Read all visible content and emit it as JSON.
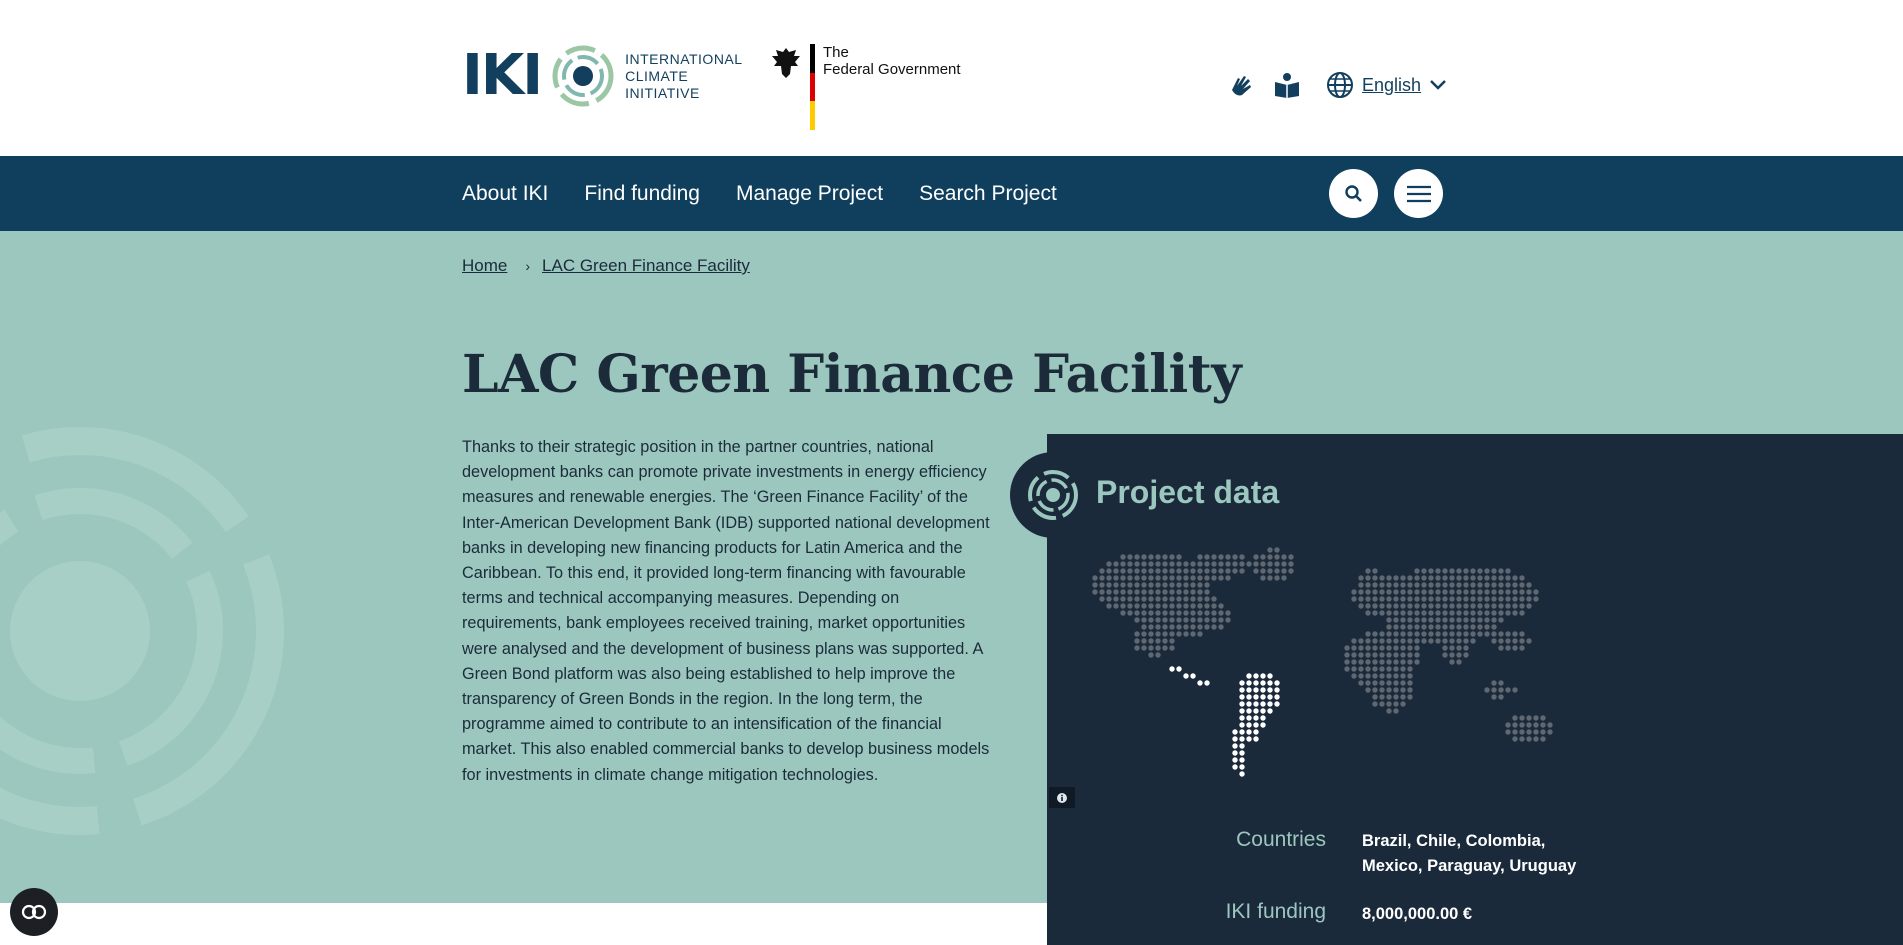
{
  "header": {
    "logo_letters": "IKI",
    "logo_text": [
      "INTERNATIONAL",
      "CLIMATE",
      "INITIATIVE"
    ],
    "gov_text": [
      "The",
      "Federal Government"
    ],
    "language": "English",
    "tools": [
      "sign-language-icon",
      "easy-read-icon",
      "globe-icon",
      "chevron-down-icon"
    ]
  },
  "nav": {
    "items": [
      "About IKI",
      "Find funding",
      "Manage Project",
      "Search Project"
    ],
    "search_icon": "search-icon",
    "menu_icon": "menu-icon"
  },
  "breadcrumb": {
    "home": "Home",
    "current": "LAC Green Finance Facility"
  },
  "page": {
    "title": "LAC Green Finance Facility",
    "intro": "Thanks to their strategic position in the partner countries, national development banks can promote private investments in energy efficiency measures and renewable energies. The ‘Green Finance Facility’ of the Inter-American Development Bank (IDB) supported national development banks in developing new financing products for Latin America and the Caribbean. To this end, it provided long-term financing with favourable terms and technical accompanying measures. Depending on requirements, bank employees received training, market opportunities were analysed and the development of business plans was supported. A Green Bond platform was also being established to help improve the transparency of Green Bonds in the region. In the long term, the programme aimed to contribute to an intensification of the financial market. This also enabled commercial banks to develop business models for investments in climate change mitigation technologies."
  },
  "project_data": {
    "title": "Project data",
    "countries_label": "Countries",
    "countries_value": [
      "Brazil, Chile, Colombia,",
      "Mexico, Paraguay, Uruguay"
    ],
    "funding_label": "IKI funding",
    "funding_value": "8,000,000.00 €"
  },
  "colors": {
    "navy": "#0f3f5d",
    "teal_bg": "#9bc7be",
    "panel": "#1b2a3b",
    "accent_green": "#9bc7be"
  }
}
